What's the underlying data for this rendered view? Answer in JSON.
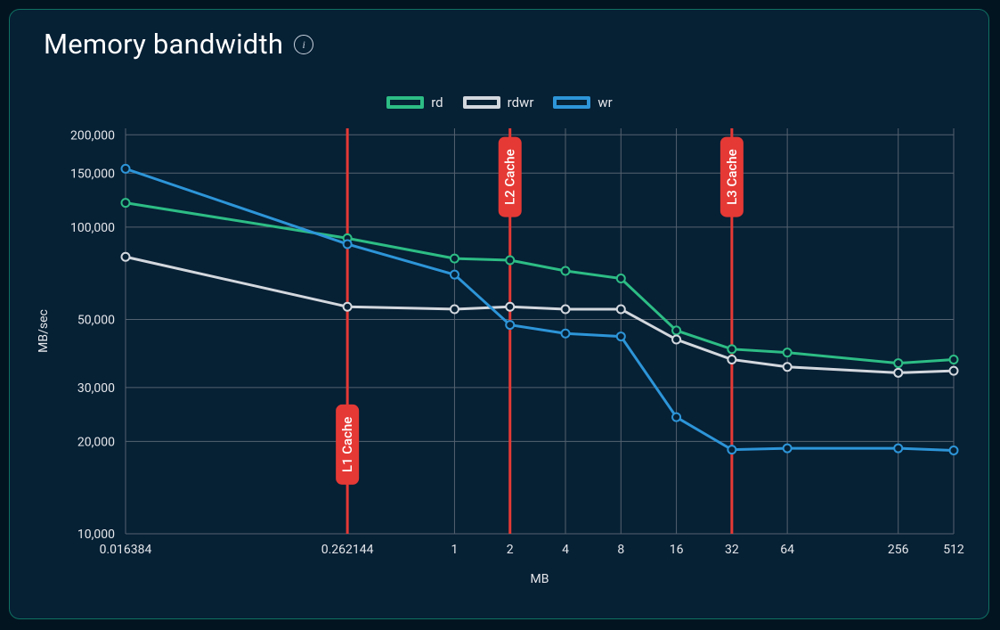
{
  "title": "Memory bandwidth",
  "legend": {
    "rd": {
      "label": "rd",
      "color": "#2dbd85",
      "fill": "#062034"
    },
    "rdwr": {
      "label": "rdwr",
      "color": "#d3d8de",
      "fill": "#062034"
    },
    "wr": {
      "label": "wr",
      "color": "#2d95d8",
      "fill": "#062034"
    }
  },
  "chart_data": {
    "type": "line",
    "title": "Memory bandwidth",
    "xlabel": "MB",
    "ylabel": "MB/sec",
    "x_scale": "log",
    "y_scale": "log",
    "x_ticks": [
      0.016384,
      0.262144,
      1,
      2,
      4,
      8,
      16,
      32,
      64,
      256,
      512
    ],
    "y_ticks": [
      10000,
      20000,
      30000,
      50000,
      100000,
      150000,
      200000
    ],
    "y_tick_labels": [
      "10,000",
      "20,000",
      "30,000",
      "50,000",
      "100,000",
      "150,000",
      "200,000"
    ],
    "xlim": [
      0.016384,
      512
    ],
    "ylim": [
      10000,
      210000
    ],
    "series": [
      {
        "name": "rd",
        "color": "#2dbd85",
        "x": [
          0.016384,
          0.262144,
          1,
          2,
          4,
          8,
          16,
          32,
          64,
          256,
          512
        ],
        "y": [
          120000,
          92000,
          79000,
          78000,
          72000,
          68000,
          46000,
          40000,
          39000,
          36000,
          37000
        ]
      },
      {
        "name": "rdwr",
        "color": "#d3d8de",
        "x": [
          0.016384,
          0.262144,
          1,
          2,
          4,
          8,
          16,
          32,
          64,
          256,
          512
        ],
        "y": [
          80000,
          55000,
          54000,
          55000,
          54000,
          54000,
          43000,
          37000,
          35000,
          33500,
          34000
        ]
      },
      {
        "name": "wr",
        "color": "#2d95d8",
        "x": [
          0.016384,
          0.262144,
          1,
          2,
          4,
          8,
          16,
          32,
          64,
          256,
          512
        ],
        "y": [
          155000,
          88000,
          70000,
          48000,
          45000,
          44000,
          24000,
          18800,
          19000,
          19000,
          18700
        ]
      }
    ],
    "annotations": [
      {
        "x": 0.262144,
        "label": "L1 Cache",
        "label_y_frac": 0.78
      },
      {
        "x": 2,
        "label": "L2 Cache",
        "label_y_frac": 0.12
      },
      {
        "x": 32,
        "label": "L3 Cache",
        "label_y_frac": 0.12
      }
    ]
  }
}
